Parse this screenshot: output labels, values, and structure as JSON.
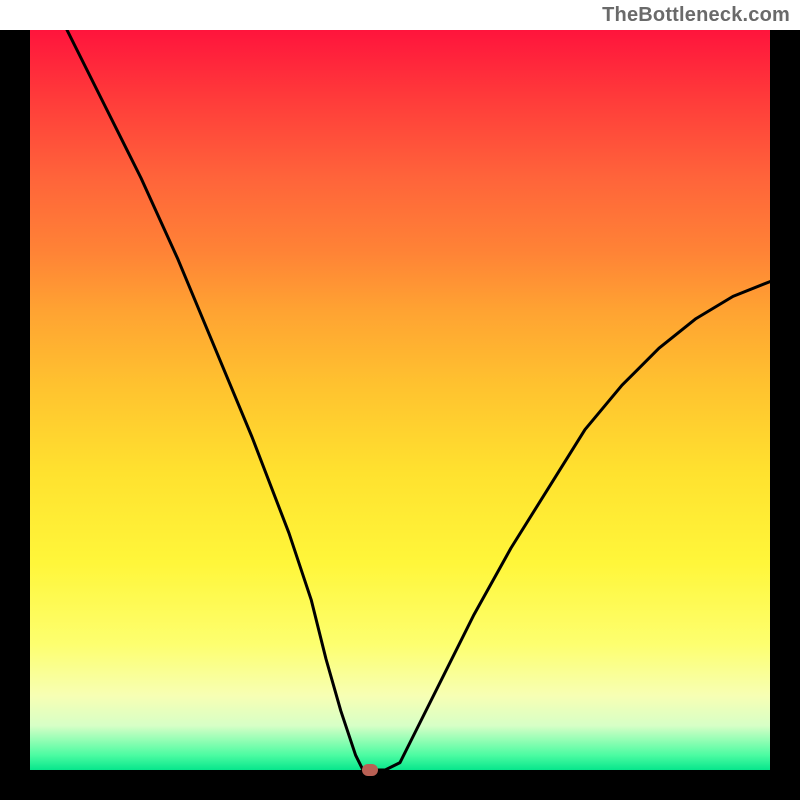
{
  "watermark": "TheBottleneck.com",
  "chart_data": {
    "type": "line",
    "title": "",
    "xlabel": "",
    "ylabel": "",
    "xlim": [
      0,
      100
    ],
    "ylim": [
      0,
      100
    ],
    "grid": false,
    "series": [
      {
        "name": "curve",
        "x": [
          5,
          10,
          15,
          20,
          25,
          30,
          35,
          38,
          40,
          42,
          44,
          45,
          48,
          50,
          52,
          56,
          60,
          65,
          70,
          75,
          80,
          85,
          90,
          95,
          100
        ],
        "y": [
          100,
          90,
          80,
          69,
          57,
          45,
          32,
          23,
          15,
          8,
          2,
          0,
          0,
          1,
          5,
          13,
          21,
          30,
          38,
          46,
          52,
          57,
          61,
          64,
          66
        ]
      }
    ],
    "marker": {
      "x": 46,
      "y": 0
    },
    "background_gradient": {
      "orientation": "vertical",
      "stops": [
        {
          "t": 0.0,
          "color": "#ff143c"
        },
        {
          "t": 0.5,
          "color": "#ffc22f"
        },
        {
          "t": 0.85,
          "color": "#fdff6f"
        },
        {
          "t": 1.0,
          "color": "#07e68c"
        }
      ]
    }
  }
}
